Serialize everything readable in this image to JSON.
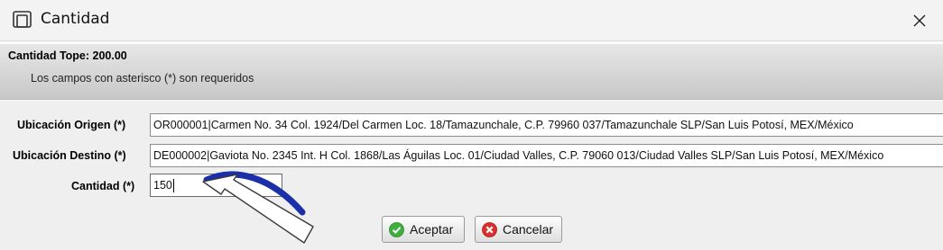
{
  "window": {
    "title": "Cantidad",
    "app_icon": "window-app-icon",
    "close_icon": "close-icon"
  },
  "header": {
    "cantidad_tope": "Cantidad Tope: 200.00",
    "hint": "Los campos con asterisco (*) son requeridos"
  },
  "form": {
    "origen_label": "Ubicación Origen (*)",
    "origen_value": "OR000001|Carmen No. 34 Col. 1924/Del Carmen Loc. 18/Tamazunchale, C.P. 79960 037/Tamazunchale SLP/San Luis Potosí, MEX/México",
    "destino_label": "Ubicación Destino (*)",
    "destino_value": "DE000002|Gaviota No. 2345 Int. H Col. 1868/Las Águilas Loc. 01/Ciudad Valles, C.P. 79060 013/Ciudad Valles SLP/San Luis Potosí, MEX/México",
    "cantidad_label": "Cantidad (*)",
    "cantidad_value": "150"
  },
  "buttons": {
    "aceptar": "Aceptar",
    "cancelar": "Cancelar",
    "aceptar_icon": "check-icon",
    "cancelar_icon": "cancel-icon"
  },
  "colors": {
    "accept_green": "#3fae3f",
    "cancel_red": "#d9302c",
    "annotation_arrow": "#1a2fa8"
  }
}
